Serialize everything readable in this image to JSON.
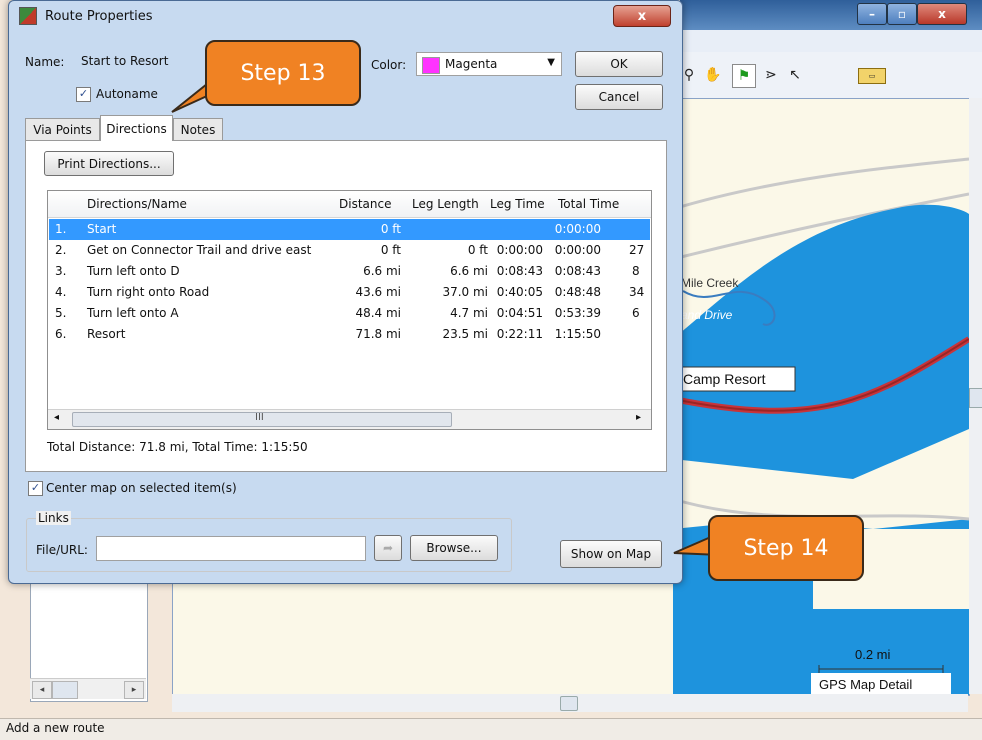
{
  "dialog": {
    "title": "Route Properties",
    "close_label": "x",
    "name_label": "Name:",
    "name_value": "Start to Resort",
    "autoname_label": "Autoname",
    "color_label": "Color:",
    "color_value": "Magenta",
    "color_swatch": "#ff33ff",
    "ok_label": "OK",
    "cancel_label": "Cancel",
    "tabs": [
      {
        "label": "Via Points"
      },
      {
        "label": "Directions"
      },
      {
        "label": "Notes"
      }
    ],
    "print_button": "Print Directions...",
    "columns": [
      "Directions/Name",
      "Distance",
      "Leg Length",
      "Leg Time",
      "Total Time"
    ],
    "rows": [
      {
        "num": "1.",
        "name": "Start",
        "distance": "0 ft",
        "leg_length": "",
        "leg_time": "",
        "total_time": "0:00:00",
        "extra": ""
      },
      {
        "num": "2.",
        "name": "Get on Connector Trail and drive east",
        "distance": "0 ft",
        "leg_length": "0 ft",
        "leg_time": "0:00:00",
        "total_time": "0:00:00",
        "extra": "27"
      },
      {
        "num": "3.",
        "name": "Turn left onto  D",
        "distance": "6.6 mi",
        "leg_length": "6.6 mi",
        "leg_time": "0:08:43",
        "total_time": "0:08:43",
        "extra": "8"
      },
      {
        "num": "4.",
        "name": "Turn right onto Road",
        "distance": "43.6 mi",
        "leg_length": "37.0 mi",
        "leg_time": "0:40:05",
        "total_time": "0:48:48",
        "extra": "34"
      },
      {
        "num": "5.",
        "name": "Turn left onto  A",
        "distance": "48.4 mi",
        "leg_length": "4.7 mi",
        "leg_time": "0:04:51",
        "total_time": "0:53:39",
        "extra": "6"
      },
      {
        "num": "6.",
        "name": "Resort",
        "distance": "71.8 mi",
        "leg_length": "23.5 mi",
        "leg_time": "0:22:11",
        "total_time": "1:15:50",
        "extra": ""
      }
    ],
    "scroll_grip": "III",
    "totals": "Total Distance: 71.8 mi, Total Time: 1:15:50",
    "center_map_label": "Center map on selected item(s)",
    "links_label": "Links",
    "file_url_label": "File/URL:",
    "file_url_value": "",
    "browse_label": "Browse...",
    "show_on_map_label": "Show on Map"
  },
  "callouts": {
    "step13": "Step 13",
    "step14": "Step 14"
  },
  "map": {
    "labels": {
      "creek": "Mile Creek",
      "drive": "and Drive",
      "resort": "Camp Resort",
      "scale": "0.2 mi",
      "detail": "GPS Map Detail"
    }
  },
  "status": {
    "text": "Add a new route"
  }
}
